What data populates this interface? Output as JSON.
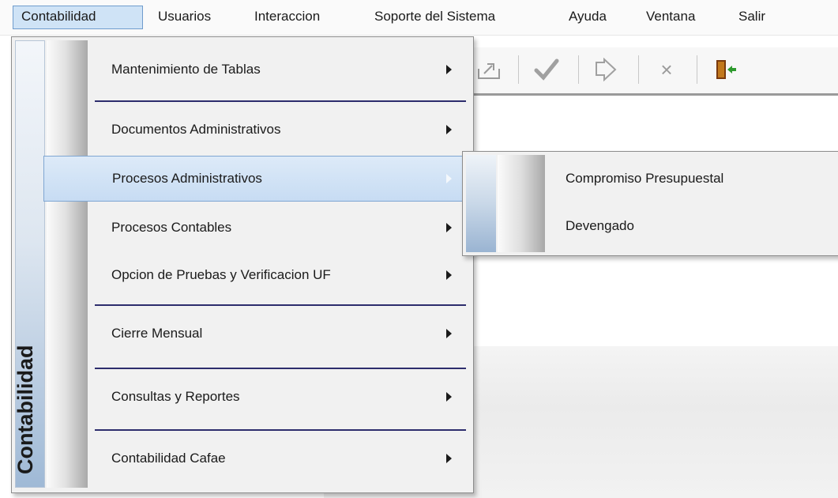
{
  "menubar": {
    "items": [
      {
        "label": "Contabilidad"
      },
      {
        "label": "Usuarios"
      },
      {
        "label": "Interaccion"
      },
      {
        "label": "Soporte del Sistema"
      },
      {
        "label": "Ayuda"
      },
      {
        "label": "Ventana"
      },
      {
        "label": "Salir"
      }
    ]
  },
  "toolbar": {
    "buttons": [
      {
        "icon": "export-icon"
      },
      {
        "icon": "check-icon"
      },
      {
        "icon": "undo-arrow-icon"
      },
      {
        "icon": "close-x-icon",
        "glyph": "×"
      },
      {
        "icon": "exit-door-icon"
      }
    ]
  },
  "dropdown": {
    "banner": "Contabilidad",
    "items": [
      {
        "label": "Mantenimiento de Tablas"
      },
      {
        "label": "Documentos Administrativos"
      },
      {
        "label": "Procesos Administrativos"
      },
      {
        "label": "Procesos Contables"
      },
      {
        "label": "Opcion de Pruebas y Verificacion UF"
      },
      {
        "label": "Cierre Mensual"
      },
      {
        "label": "Consultas y Reportes"
      },
      {
        "label": "Contabilidad Cafae"
      }
    ]
  },
  "submenu": {
    "items": [
      {
        "label": "Compromiso Presupuestal"
      },
      {
        "label": "Devengado"
      }
    ]
  },
  "colors": {
    "highlight": "#c7dcf3",
    "highlight_border": "#7fa6d2",
    "separator": "#2d2d6d"
  }
}
